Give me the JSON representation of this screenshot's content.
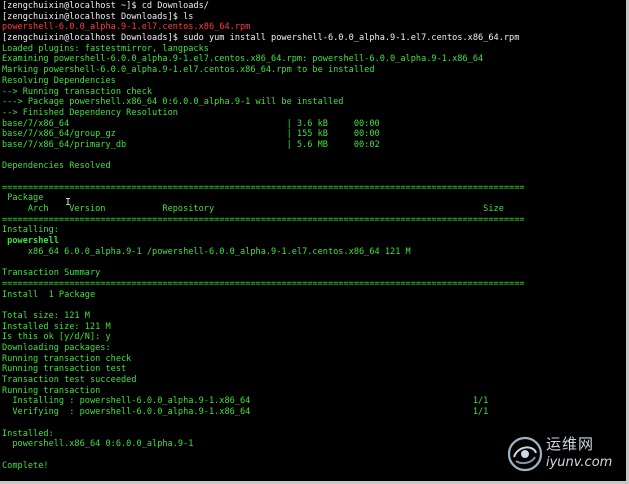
{
  "terminal": {
    "lines": [
      {
        "text": "[zengchuixin@localhost ~]$ cd Downloads/",
        "color": "white"
      },
      {
        "text": "[zengchuixin@localhost Downloads]$ ls",
        "color": "white"
      },
      {
        "text": "powershell-6.0.0_alpha.9-1.el7.centos.x86_64.rpm",
        "color": "red"
      },
      {
        "text": "[zengchuixin@localhost Downloads]$ sudo yum install powershell-6.0.0_alpha.9-1.el7.centos.x86_64.rpm",
        "color": "white"
      },
      {
        "text": "Loaded plugins: fastestmirror, langpacks",
        "color": "green"
      },
      {
        "text": "Examining powershell-6.0.0_alpha.9-1.el7.centos.x86_64.rpm: powershell-6.0.0_alpha.9-1.x86_64",
        "color": "green"
      },
      {
        "text": "Marking powershell-6.0.0_alpha.9-1.el7.centos.x86_64.rpm to be installed",
        "color": "green"
      },
      {
        "text": "Resolving Dependencies",
        "color": "green"
      },
      {
        "text": "--> Running transaction check",
        "color": "green"
      },
      {
        "text": "---> Package powershell.x86_64 0:6.0.0_alpha.9-1 will be installed",
        "color": "green"
      },
      {
        "text": "--> Finished Dependency Resolution",
        "color": "green"
      },
      {
        "text": "base/7/x86_64                                          | 3.6 kB     00:00",
        "color": "green"
      },
      {
        "text": "base/7/x86_64/group_gz                                 | 155 kB     00:00",
        "color": "green"
      },
      {
        "text": "base/7/x86_64/primary_db                               | 5.6 MB     00:02",
        "color": "green"
      },
      {
        "text": "",
        "color": "green"
      },
      {
        "text": "Dependencies Resolved",
        "color": "green"
      },
      {
        "text": "",
        "color": "green"
      },
      {
        "text": "=====================================================================================================",
        "color": "green"
      },
      {
        "text": " Package",
        "color": "green"
      },
      {
        "text": "     Arch    Version           Repository                                                    Size",
        "color": "green"
      },
      {
        "text": "=====================================================================================================",
        "color": "green"
      },
      {
        "text": "Installing:",
        "color": "green"
      },
      {
        "text": " powershell",
        "color": "green",
        "bold": true
      },
      {
        "text": "     x86_64 6.0.0_alpha.9-1 /powershell-6.0.0_alpha.9-1.el7.centos.x86_64 121 M",
        "color": "green"
      },
      {
        "text": "",
        "color": "green"
      },
      {
        "text": "Transaction Summary",
        "color": "green"
      },
      {
        "text": "=====================================================================================================",
        "color": "green"
      },
      {
        "text": "Install  1 Package",
        "color": "green"
      },
      {
        "text": "",
        "color": "green"
      },
      {
        "text": "Total size: 121 M",
        "color": "green"
      },
      {
        "text": "Installed size: 121 M",
        "color": "green"
      },
      {
        "text": "Is this ok [y/d/N]: y",
        "color": "green"
      },
      {
        "text": "Downloading packages:",
        "color": "green"
      },
      {
        "text": "Running transaction check",
        "color": "green"
      },
      {
        "text": "Running transaction test",
        "color": "green"
      },
      {
        "text": "Transaction test succeeded",
        "color": "green"
      },
      {
        "text": "Running transaction",
        "color": "green"
      },
      {
        "text": "  Installing : powershell-6.0.0_alpha.9-1.x86_64                                           1/1",
        "color": "green"
      },
      {
        "text": "  Verifying  : powershell-6.0.0_alpha.9-1.x86_64                                           1/1",
        "color": "green"
      },
      {
        "text": "",
        "color": "green"
      },
      {
        "text": "Installed:",
        "color": "green"
      },
      {
        "text": "  powershell.x86_64 0:6.0.0_alpha.9-1",
        "color": "green"
      },
      {
        "text": "",
        "color": "green"
      },
      {
        "text": "Complete!",
        "color": "green"
      }
    ]
  },
  "watermark": {
    "line1": "运维网",
    "line2": "iyunv.com"
  },
  "colors": {
    "background": "#000000",
    "text_white": "#f0f0f0",
    "text_green": "#3fe03f",
    "text_red": "#ff3b3b"
  },
  "icons": {
    "cursor": "text-cursor-icon",
    "watermark_logo": "swirl-logo-icon"
  }
}
